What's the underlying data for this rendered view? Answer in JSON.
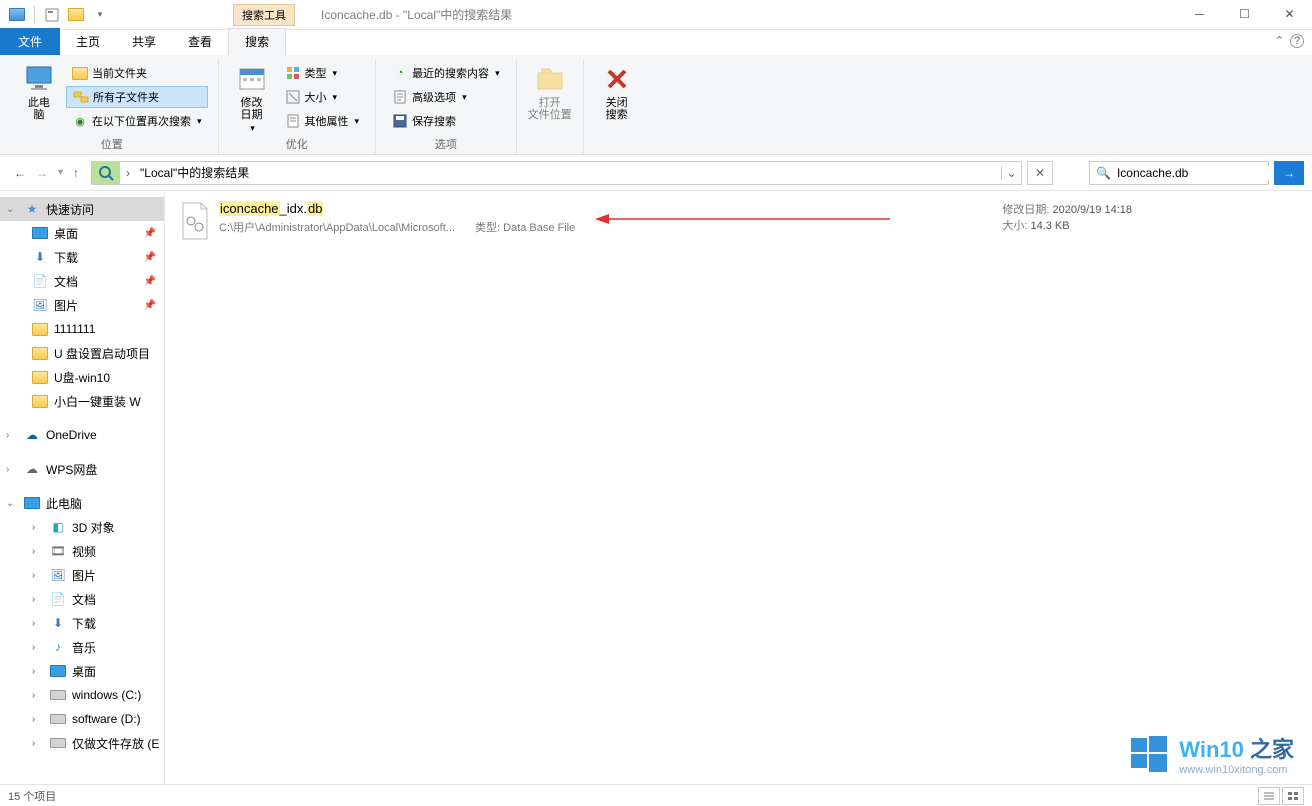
{
  "titlebar": {
    "tool_tab": "搜索工具",
    "title": "Iconcache.db - \"Local\"中的搜索结果"
  },
  "tabs": {
    "file": "文件",
    "home": "主页",
    "share": "共享",
    "view": "查看",
    "search": "搜索"
  },
  "ribbon": {
    "this_pc": "此电\n脑",
    "current_folder": "当前文件夹",
    "all_subfolders": "所有子文件夹",
    "search_again": "在以下位置再次搜索",
    "group_location": "位置",
    "modify_date": "修改\n日期",
    "type": "类型",
    "size": "大小",
    "other_props": "其他属性",
    "group_refine": "优化",
    "recent_searches": "最近的搜索内容",
    "advanced_options": "高级选项",
    "save_search": "保存搜索",
    "group_options": "选项",
    "open_location": "打开\n文件位置",
    "close_search": "关闭\n搜索"
  },
  "address": {
    "path": "\"Local\"中的搜索结果",
    "search_value": "Iconcache.db"
  },
  "sidebar": {
    "quick_access": "快速访问",
    "items": [
      {
        "label": "桌面",
        "pinned": true,
        "type": "monitor"
      },
      {
        "label": "下载",
        "pinned": true,
        "type": "download"
      },
      {
        "label": "文档",
        "pinned": true,
        "type": "doc"
      },
      {
        "label": "图片",
        "pinned": true,
        "type": "pic"
      },
      {
        "label": "1111111",
        "pinned": false,
        "type": "folder"
      },
      {
        "label": "U 盘设置启动项目",
        "pinned": false,
        "type": "folder"
      },
      {
        "label": "U盘-win10",
        "pinned": false,
        "type": "folder"
      },
      {
        "label": "小白一键重装 W",
        "pinned": false,
        "type": "folder"
      }
    ],
    "onedrive": "OneDrive",
    "wps": "WPS网盘",
    "this_pc": "此电脑",
    "pc_items": [
      {
        "label": "3D 对象"
      },
      {
        "label": "视频"
      },
      {
        "label": "图片"
      },
      {
        "label": "文档"
      },
      {
        "label": "下载"
      },
      {
        "label": "音乐"
      },
      {
        "label": "桌面"
      },
      {
        "label": "windows (C:)"
      },
      {
        "label": "software (D:)"
      },
      {
        "label": "仅做文件存放 (E"
      }
    ]
  },
  "result": {
    "name_pre": "iconcache",
    "name_mid": "_idx.",
    "name_post": "db",
    "path": "C:\\用户\\Administrator\\AppData\\Local\\Microsoft...",
    "type_label": "类型:",
    "type_value": "Data Base File",
    "date_label": "修改日期:",
    "date_value": "2020/9/19 14:18",
    "size_label": "大小:",
    "size_value": "14.3 KB"
  },
  "status": {
    "count": "15 个项目"
  },
  "watermark": {
    "line1a": "Win10",
    "line1b": "之家",
    "line2": "www.win10xitong.com"
  }
}
